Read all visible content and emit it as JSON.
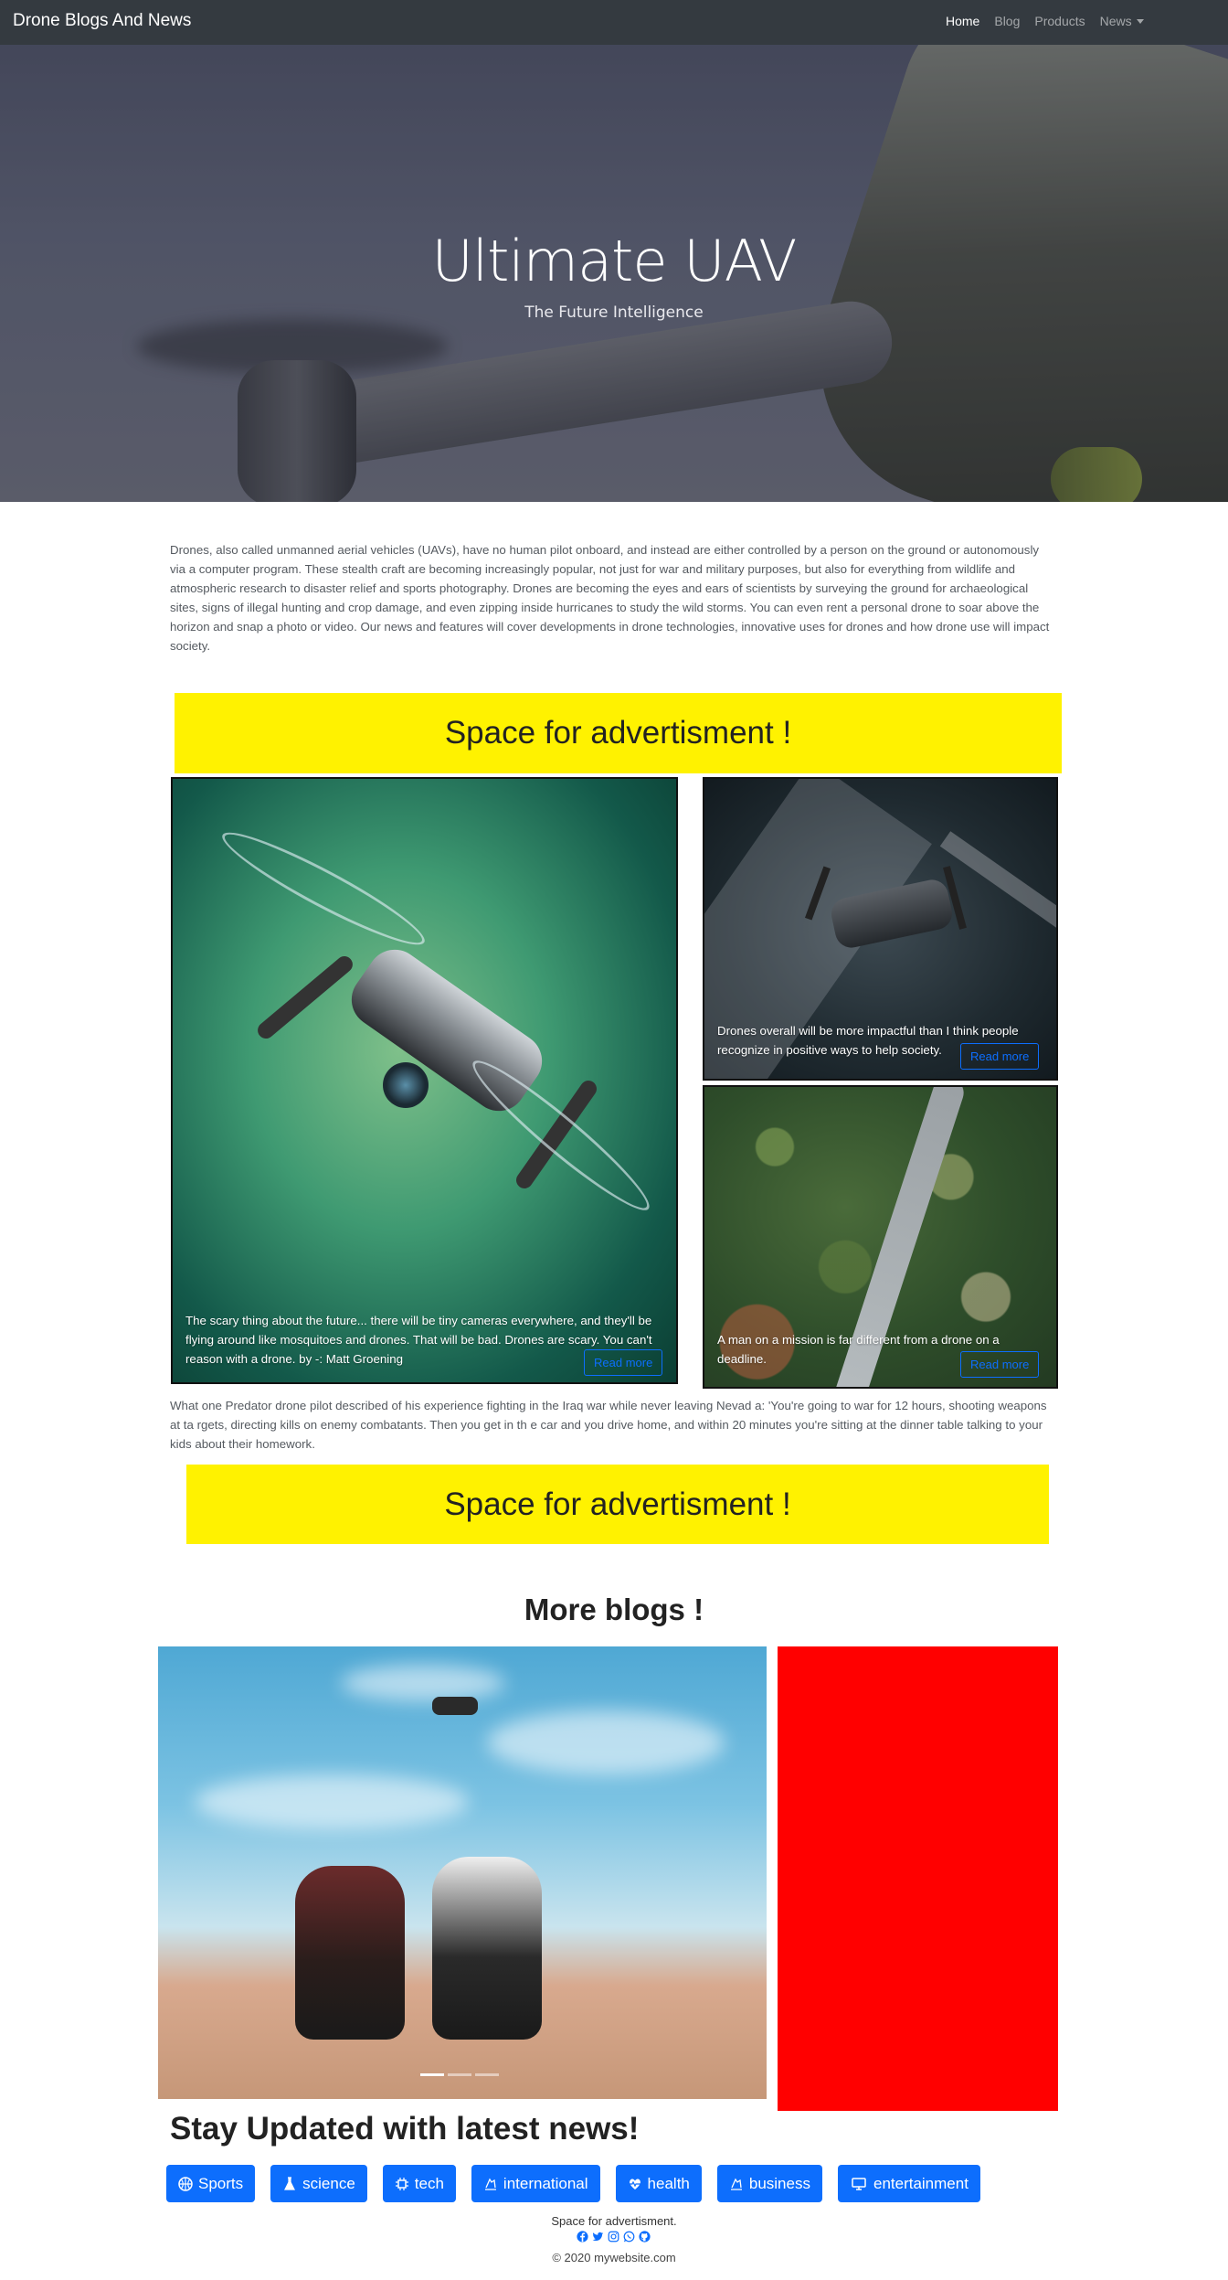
{
  "navbar": {
    "brand": "Drone Blogs And News",
    "links": [
      {
        "label": "Home",
        "active": true
      },
      {
        "label": "Blog",
        "active": false
      },
      {
        "label": "Products",
        "active": false
      },
      {
        "label": "News",
        "active": false,
        "dropdown": true
      }
    ]
  },
  "hero": {
    "title": "Ultimate UAV",
    "subtitle": "The Future Intelligence"
  },
  "intro": {
    "text": "Drones, also called unmanned aerial vehicles (UAVs), have no human pilot onboard, and instead are either controlled by a person on the ground or autonomously via a computer program. These stealth craft are becoming increasingly popular, not just for war and military purposes, but also for everything from wildlife and atmospheric research to disaster relief and sports photography. Drones are becoming the eyes and ears of scientists by surveying the ground for archaeological sites, signs of illegal hunting and crop damage, and even zipping inside hurricanes to study the wild storms. You can even rent a personal drone to soar above the horizon and snap a photo or video. Our news and features will cover developments in drone technologies, innovative uses for drones and how drone use will impact society."
  },
  "ads": {
    "top": "Space for advertisment !",
    "bottom": "Space for advertisment !"
  },
  "cards": {
    "big": {
      "text": "The scary thing about the future... there will be tiny cameras everywhere, and they'll be flying around like mosquitoes and drones. That will be bad. Drones are scary. You can't reason with a drone. by -: Matt Groening",
      "button": "Read more"
    },
    "top_right": {
      "text": "Drones overall will be more impactful than I think people recognize in positive ways to help society.",
      "button": "Read more"
    },
    "bottom_right": {
      "text": "A man on a mission is far different from a drone on a deadline.",
      "button": "Read more"
    }
  },
  "quote": {
    "text": "What one Predator drone pilot described of his experience fighting in the Iraq war while never leaving Nevad a: 'You're going to war for 12 hours, shooting weapons at ta rgets, directing kills on enemy combatants. Then you get in th e car and you drive home, and within 20 minutes you're sitting at the dinner table talking to your kids about their homework."
  },
  "more_blogs": {
    "title": "More blogs !",
    "carousel_indicators": 3,
    "active_indicator": 0
  },
  "stay_updated": {
    "title": "Stay Updated with latest news!",
    "categories": [
      {
        "label": "Sports",
        "icon": "basketball-icon"
      },
      {
        "label": "science",
        "icon": "flask-icon"
      },
      {
        "label": "tech",
        "icon": "cpu-icon"
      },
      {
        "label": "international",
        "icon": "globe-icon"
      },
      {
        "label": "health",
        "icon": "heart-pulse-icon"
      },
      {
        "label": "business",
        "icon": "chart-icon"
      },
      {
        "label": "entertainment",
        "icon": "monitor-icon"
      }
    ]
  },
  "footer": {
    "ad_text": "Space for advertisment.",
    "socials": [
      "facebook-icon",
      "twitter-icon",
      "instagram-icon",
      "whatsapp-icon",
      "github-icon"
    ],
    "copyright": "© 2020 mywebsite.com"
  },
  "colors": {
    "navbar": "#343a40",
    "ad": "#fff200",
    "primary": "#0d6efd",
    "red_box": "#ff0000"
  }
}
